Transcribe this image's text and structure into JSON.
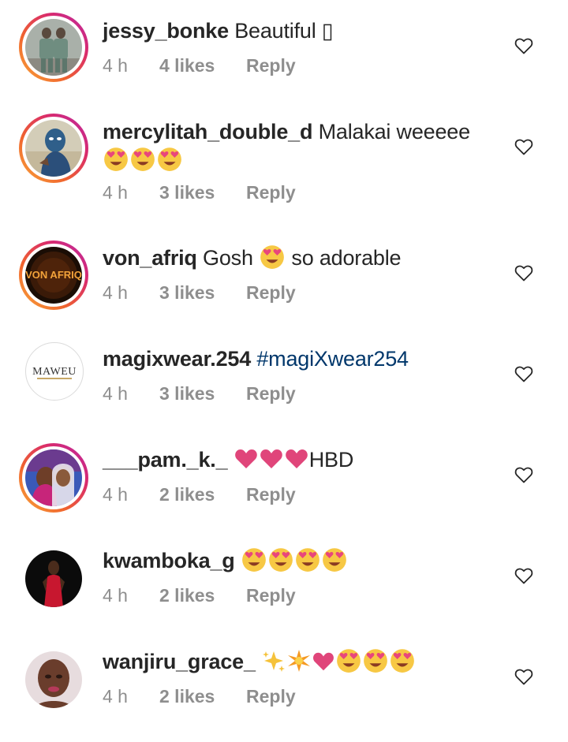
{
  "comments": [
    {
      "username": "jessy_bonke",
      "text": "Beautiful ▯",
      "time": "4 h",
      "likes": "4 likes",
      "reply": "Reply"
    },
    {
      "username": "mercylitah_double_d",
      "text": "Malakai weeeee",
      "time": "4 h",
      "likes": "3 likes",
      "reply": "Reply"
    },
    {
      "username": "von_afriq",
      "text": "Gosh",
      "text_after": "so adorable",
      "avatar_text": "VON AFRIQ",
      "time": "4 h",
      "likes": "3 likes",
      "reply": "Reply"
    },
    {
      "username": "magixwear.254",
      "text": "#magiXwear254",
      "avatar_text": "MAWEU",
      "time": "4 h",
      "likes": "3 likes",
      "reply": "Reply"
    },
    {
      "username": "___pam._k._",
      "text": "HBD",
      "time": "4 h",
      "likes": "2 likes",
      "reply": "Reply"
    },
    {
      "username": "kwamboka_g",
      "time": "4 h",
      "likes": "2 likes",
      "reply": "Reply"
    },
    {
      "username": "wanjiru_grace_",
      "time": "4 h",
      "likes": "2 likes",
      "reply": "Reply"
    }
  ],
  "icons": {
    "like": "heart-outline-icon",
    "heart_eyes": "heart-eyes-emoji",
    "pink_heart": "pink-heart-emoji",
    "sparkles": "sparkles-emoji",
    "sparkle_star": "sparkle-star-emoji"
  },
  "colors": {
    "username": "#262626",
    "meta": "#8e8e8e",
    "hashtag": "#00376b",
    "ring_start": "#f9a93b",
    "ring_end": "#b92aa8",
    "emoji_heart": "#e8467c"
  }
}
